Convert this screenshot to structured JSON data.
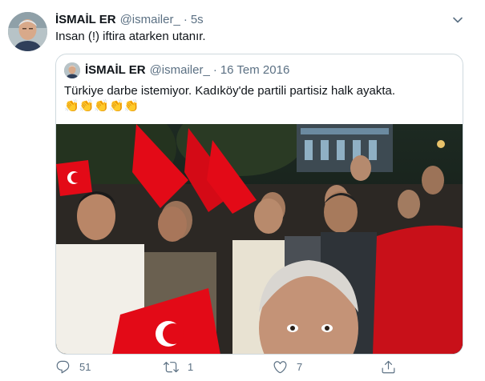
{
  "tweet": {
    "author_name": "İSMAİL ER",
    "author_handle": "@ismailer_",
    "separator": "·",
    "timestamp": "5s",
    "text": "Insan (!) iftira atarken utanır."
  },
  "quote": {
    "author_name": "İSMAİL ER",
    "author_handle": "@ismailer_",
    "separator": "·",
    "timestamp": "16 Tem 2016",
    "text": "Türkiye darbe istemiyor. Kadıköy'de partili partisiz halk ayakta.",
    "emojis": "👏👏👏👏👏"
  },
  "actions": {
    "reply": {
      "icon": "reply-icon",
      "count": "51"
    },
    "retweet": {
      "icon": "retweet-icon",
      "count": "1"
    },
    "like": {
      "icon": "heart-icon",
      "count": "7"
    },
    "share": {
      "icon": "share-icon",
      "count": ""
    }
  },
  "colors": {
    "text": "#0f1419",
    "secondary": "#5b7083",
    "border": "#cfd9de",
    "flag_red": "#e30a17"
  }
}
